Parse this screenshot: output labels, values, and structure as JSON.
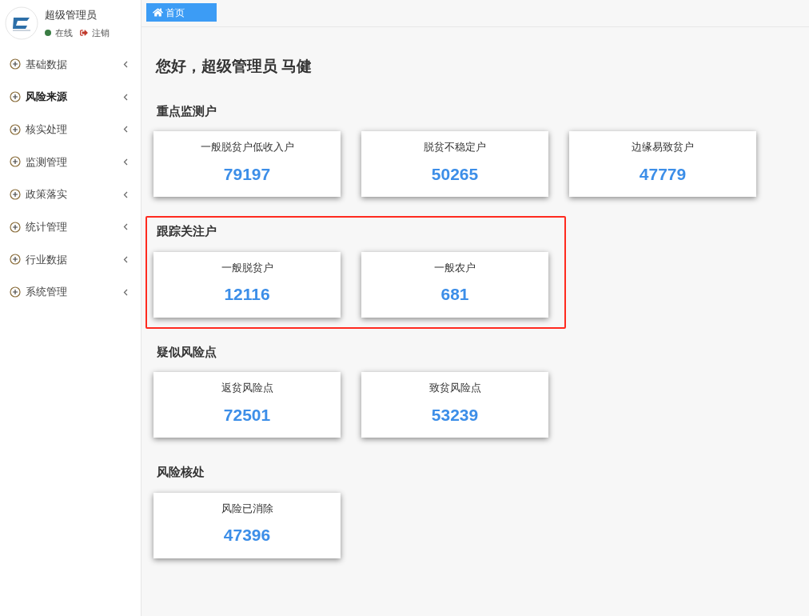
{
  "user": {
    "name": "超级管理员",
    "status": "在线",
    "logout": "注销"
  },
  "menu": [
    {
      "label": "基础数据",
      "selected": false
    },
    {
      "label": "风险来源",
      "selected": true
    },
    {
      "label": "核实处理",
      "selected": false
    },
    {
      "label": "监测管理",
      "selected": false
    },
    {
      "label": "政策落实",
      "selected": false
    },
    {
      "label": "统计管理",
      "selected": false
    },
    {
      "label": "行业数据",
      "selected": false
    },
    {
      "label": "系统管理",
      "selected": false
    }
  ],
  "tabs": [
    {
      "label": "首页",
      "selected": true
    }
  ],
  "greeting": "您好，超级管理员 马健",
  "sections": [
    {
      "title": "重点监测户",
      "highlighted": false,
      "cards": [
        {
          "label": "一般脱贫户低收入户",
          "value": "79197"
        },
        {
          "label": "脱贫不稳定户",
          "value": "50265"
        },
        {
          "label": "边缘易致贫户",
          "value": "47779"
        }
      ]
    },
    {
      "title": "跟踪关注户",
      "highlighted": true,
      "cards": [
        {
          "label": "一般脱贫户",
          "value": "12116"
        },
        {
          "label": "一般农户",
          "value": "681"
        }
      ]
    },
    {
      "title": "疑似风险点",
      "highlighted": false,
      "cards": [
        {
          "label": "返贫风险点",
          "value": "72501"
        },
        {
          "label": "致贫风险点",
          "value": "53239"
        }
      ]
    },
    {
      "title": "风险核处",
      "highlighted": false,
      "cards": [
        {
          "label": "风险已消除",
          "value": "47396"
        }
      ]
    }
  ]
}
